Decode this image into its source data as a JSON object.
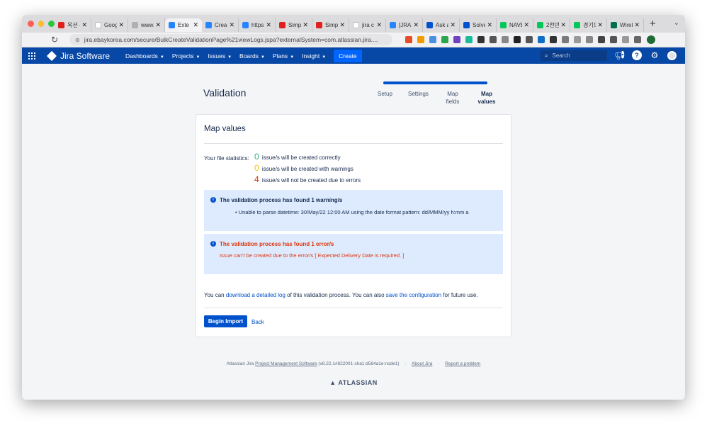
{
  "browser": {
    "tabs": [
      {
        "label": "옥션 -",
        "icon": "auction-icon",
        "color": "#e0201b"
      },
      {
        "label": "Goog",
        "icon": "google-icon",
        "color": "#ffffff"
      },
      {
        "label": "www.",
        "icon": "globe-icon",
        "color": "#b0b0b0"
      },
      {
        "label": "Exte",
        "icon": "jira-icon",
        "color": "#2684ff"
      },
      {
        "label": "Crea",
        "icon": "jira-icon",
        "color": "#2684ff"
      },
      {
        "label": "https",
        "icon": "jira-icon",
        "color": "#2684ff"
      },
      {
        "label": "Simp",
        "icon": "simple-icon",
        "color": "#e0201b"
      },
      {
        "label": "Simp",
        "icon": "simple-icon",
        "color": "#e0201b"
      },
      {
        "label": "jira c",
        "icon": "google-icon",
        "color": "#ffffff"
      },
      {
        "label": "[JRA",
        "icon": "jira-icon",
        "color": "#2684ff"
      },
      {
        "label": "Ask a",
        "icon": "atlassian-icon",
        "color": "#0052cc"
      },
      {
        "label": "Solve",
        "icon": "atlassian-icon",
        "color": "#0052cc"
      },
      {
        "label": "NAVE",
        "icon": "naver-icon",
        "color": "#03c75a"
      },
      {
        "label": "2천만",
        "icon": "naver-icon",
        "color": "#03c75a"
      },
      {
        "label": "경기도",
        "icon": "naver-icon",
        "color": "#03c75a"
      },
      {
        "label": "Wirel",
        "icon": "starbucks-icon",
        "color": "#00704a"
      }
    ],
    "active_tab": 3,
    "url": "jira.ebaykorea.com/secure/BulkCreateValidationPage%21viewLogs.jspa?externalSystem=com.atlassian.jira....",
    "extension_colors": [
      "#e34c26",
      "#f59b00",
      "#4a90e2",
      "#2ea44f",
      "#6f42c1",
      "#1abc9c",
      "#333333",
      "#555555",
      "#888888",
      "#222222",
      "#555555",
      "#0f6fc6",
      "#333333",
      "#7a7a7a",
      "#999999",
      "#888888",
      "#444444",
      "#555555",
      "#999999",
      "#666666"
    ]
  },
  "jira": {
    "brand": "Jira Software",
    "nav": [
      {
        "label": "Dashboards"
      },
      {
        "label": "Projects"
      },
      {
        "label": "Issues"
      },
      {
        "label": "Boards"
      },
      {
        "label": "Plans"
      },
      {
        "label": "Insight"
      }
    ],
    "create_label": "Create",
    "search_placeholder": "Search",
    "colors": {
      "header": "#0747a6",
      "primary": "#0052cc",
      "error": "#de350b"
    }
  },
  "page": {
    "title": "Validation",
    "steps": [
      {
        "label": "Setup"
      },
      {
        "label": "Settings"
      },
      {
        "label": "Map fields"
      },
      {
        "label": "Map values",
        "current": true
      }
    ],
    "section_title": "Map values",
    "stats_label": "Your file statistics:",
    "stats": [
      {
        "count": "0",
        "text": "issue/s will be created correctly",
        "color": "#36b37e"
      },
      {
        "count": "0",
        "text": "issue/s will be created with warnings",
        "color": "#ffc400"
      },
      {
        "count": "4",
        "text": "issue/s will not be created due to errors",
        "color": "#de350b"
      }
    ],
    "warning": {
      "title": "The validation process has found 1 warning/s",
      "item": "Unable to parse datetime: 30/May/22 12:00 AM using the date format pattern: dd/MMM/yy h:mm a"
    },
    "error": {
      "title": "The validation process has found 1 error/s",
      "item": "Issue can't be created due to the error/s [ Expected Delivery Date is required. ]"
    },
    "footer_text": {
      "p1": "You can ",
      "link1": "download a detailed log",
      "p2": " of this validation process. You can also ",
      "link2": "save the configuration",
      "p3": " for future use."
    },
    "begin_import": "Begin Import",
    "back": "Back"
  },
  "footer": {
    "prefix": "Atlassian Jira ",
    "pms": "Project Management Software",
    "version": " (v8.22.1#822001-sha1:d584a1e:node1)",
    "sep": "·",
    "about": "About Jira",
    "report": "Report a problem",
    "atlassian": "ATLASSIAN"
  }
}
